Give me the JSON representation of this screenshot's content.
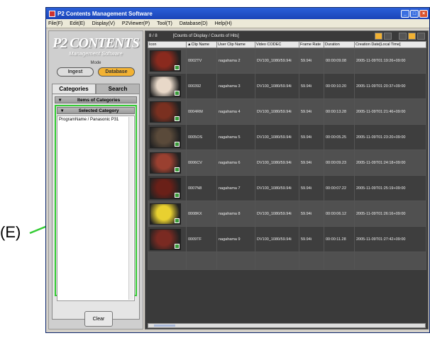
{
  "callout": {
    "label": "(E)"
  },
  "window": {
    "title": "P2 Contents Management Software",
    "controls": [
      "_",
      "□",
      "×"
    ]
  },
  "menu": [
    "File(F)",
    "Edit(E)",
    "Display(V)",
    "P2Viewer(P)",
    "Tool(T)",
    "Database(D)",
    "Help(H)"
  ],
  "left_panel": {
    "logo_title": "P2 CONTENTS",
    "logo_subtitle": "Management Software",
    "mode_label": "Mode",
    "mode_ingest": "Ingest",
    "mode_database": "Database",
    "tab_categories": "Categories",
    "tab_search": "Search",
    "items_of_categories": "Items of Categories",
    "selected_category": "Selected Category",
    "selected_category_value": "ProgramName / Panasonic P31",
    "clear_button": "Clear"
  },
  "right_panel": {
    "count": "8 / 8",
    "count_label": "[Counts of Display / Counts of Hits]",
    "columns": [
      "Icon",
      "▲Clip Name",
      "User Clip Name",
      "Video CODEC",
      "Frame Rate",
      "Duration",
      "Creation Date[Local Time]"
    ],
    "rows": [
      {
        "clip": "0002TV",
        "user": "nagahama 2",
        "codec": "DV100_1080/59.94i",
        "rate": "59.94i",
        "duration": "00:00:09.08",
        "date": "2005-11-09T01:19:26+09:00"
      },
      {
        "clip": "000392",
        "user": "nagahama 3",
        "codec": "DV100_1080/59.94i",
        "rate": "59.94i",
        "duration": "00:00:10.20",
        "date": "2005-11-09T01:20:37+09:00"
      },
      {
        "clip": "0004RM",
        "user": "nagahama 4",
        "codec": "DV100_1080/59.94i",
        "rate": "59.94i",
        "duration": "00:00:13.28",
        "date": "2005-11-09T01:21:46+09:00"
      },
      {
        "clip": "0005OS",
        "user": "nagahama 5",
        "codec": "DV100_1080/59.94i",
        "rate": "59.94i",
        "duration": "00:00:05.25",
        "date": "2005-11-09T01:23:20+09:00"
      },
      {
        "clip": "0006CV",
        "user": "nagahama 6",
        "codec": "DV100_1080/59.94i",
        "rate": "59.94i",
        "duration": "00:00:09.23",
        "date": "2005-11-09T01:24:18+09:00"
      },
      {
        "clip": "0007N8",
        "user": "nagahama 7",
        "codec": "DV100_1080/59.94i",
        "rate": "59.94i",
        "duration": "00:00:07.22",
        "date": "2005-11-09T01:25:19+09:00"
      },
      {
        "clip": "0008KX",
        "user": "nagahama 8",
        "codec": "DV100_1080/59.94i",
        "rate": "59.94i",
        "duration": "00:00:06.12",
        "date": "2005-11-09T01:26:16+09:00"
      },
      {
        "clip": "0009TF",
        "user": "nagahama 9",
        "codec": "DV100_1080/59.94i",
        "rate": "59.94i",
        "duration": "00:00:11.28",
        "date": "2005-11-09T01:27:42+09:00"
      }
    ],
    "thumb_colors": [
      "#8a2a1e",
      "#e8d8c8",
      "#7a3020",
      "#5a4a3a",
      "#9a4030",
      "#6a2018",
      "#e8d030",
      "#7a2a22"
    ]
  },
  "colors": {
    "highlight": "#33cc33",
    "accent": "#f2b233"
  }
}
